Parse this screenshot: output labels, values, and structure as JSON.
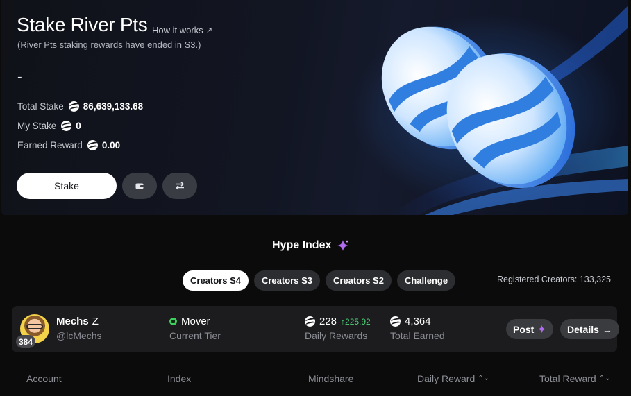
{
  "hero": {
    "title": "Stake River Pts",
    "how_link": "How it works",
    "subtitle": "(River Pts staking rewards have ended in S3.)",
    "dash": "-",
    "stats": [
      {
        "label": "Total Stake",
        "value": "86,639,133.68"
      },
      {
        "label": "My Stake",
        "value": "0"
      },
      {
        "label": "Earned Reward",
        "value": "0.00"
      }
    ],
    "stake_button": "Stake"
  },
  "hype": {
    "title": "Hype Index",
    "tabs": [
      "Creators S4",
      "Creators S3",
      "Creators S2",
      "Challenge"
    ],
    "active_tab": "Creators S4",
    "registered": "Registered Creators: 133,325"
  },
  "creator": {
    "rank": "384",
    "name": "Mechs",
    "name_suffix": "Z",
    "handle": "@lcMechs",
    "tier": "Mover",
    "tier_label": "Current Tier",
    "daily_value": "228",
    "daily_delta": "225.92",
    "daily_label": "Daily Rewards",
    "earned_value": "4,364",
    "earned_label": "Total Earned",
    "post_button": "Post",
    "details_button": "Details"
  },
  "table": {
    "headers": [
      "Account",
      "Index",
      "Mindshare",
      "Daily Reward",
      "Total Reward"
    ]
  },
  "colors": {
    "accent_green": "#4cd37a",
    "sparkle": "#b06cf0",
    "tab_active_bg": "#ffffff",
    "tab_bg": "#2c2d31"
  }
}
